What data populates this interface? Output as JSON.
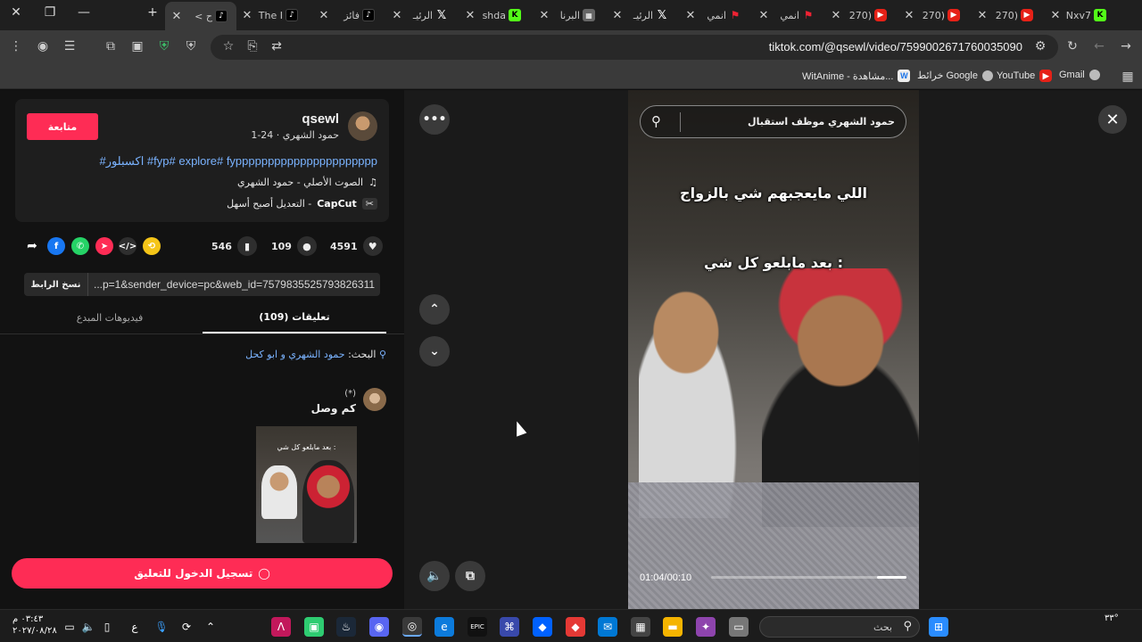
{
  "browser": {
    "tabs": [
      {
        "title": "Nxv7",
        "favicon": "kick"
      },
      {
        "title": "(270",
        "favicon": "youtube"
      },
      {
        "title": "(270",
        "favicon": "youtube"
      },
      {
        "title": "(270",
        "favicon": "youtube"
      },
      {
        "title": "انمي",
        "favicon": "red"
      },
      {
        "title": "انمي",
        "favicon": "red"
      },
      {
        "title": "الرئيـ",
        "favicon": "x"
      },
      {
        "title": "البرنا",
        "favicon": "grid"
      },
      {
        "title": "shda",
        "favicon": "kick"
      },
      {
        "title": "الرئيـ",
        "favicon": "x"
      },
      {
        "title": "فائز",
        "favicon": "tiktok"
      },
      {
        "title": "The I",
        "favicon": "tiktok"
      },
      {
        "title": "ح >",
        "favicon": "tiktok"
      }
    ],
    "url": "tiktok.com/@qsewl/video/7599002671760035090",
    "bookmarks": [
      {
        "label": "Gmail",
        "color": "#ea4335"
      },
      {
        "label": "YouTube",
        "color": "#ff0000"
      },
      {
        "label": "خرائط Google",
        "color": "#34a853"
      },
      {
        "label": "WitAnime - مشاهدة...",
        "color": "#00b2ff"
      }
    ]
  },
  "post": {
    "username": "qsewl",
    "display_name_date": "حمود الشهري · 24-1",
    "follow_label": "متابعة",
    "hashtags": "#اكسبلور #fyp# explore# fypppppppppppppppppppppp",
    "music": "الصوت الأصلي - حمود الشهري",
    "capcut_brand": "CapCut",
    "capcut_text": "التعديل أصبح أسهل -",
    "likes": "4591",
    "comments": "109",
    "saves": "546",
    "link_text": "...p=1&sender_device=pc&web_id=7579835525793826311",
    "copy_link_label": "نسخ الرابط"
  },
  "tabs": {
    "comments_label": "(109) تعليقات",
    "videos_label": "فيديوهات المبدع"
  },
  "search_suggest": {
    "prefix": "البحث:",
    "query": "حمود الشهري و ابو كحل"
  },
  "comment": {
    "author": "(*)",
    "text": "كم وصل",
    "thumb_caption": "بعد مابلعو كل شي :"
  },
  "login_label": "تسجيل الدخول للتعليق",
  "video": {
    "search_text": "حمود الشهري موظف استقبال",
    "caption1": "اللي مايعجبهم شي بالزواج",
    "caption2": "بعد مابلعو كل شي :",
    "time": "01:04/00:10",
    "progress_fraction": 0.15
  },
  "taskbar": {
    "time": "٠٣:٤٣ م",
    "date": "٢٠٢٧/٠٨/٢٨",
    "search_placeholder": "بحث",
    "temperature": "٣٣°",
    "lang": "ع"
  }
}
